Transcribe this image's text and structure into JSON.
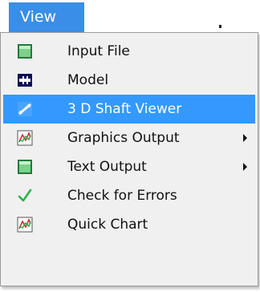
{
  "menubar": {
    "title": "View"
  },
  "menu": {
    "items": [
      {
        "label": "Input File",
        "icon": "input-file-icon",
        "submenu": false,
        "selected": false
      },
      {
        "label": "Model",
        "icon": "model-icon",
        "submenu": false,
        "selected": false
      },
      {
        "label": "3 D Shaft Viewer",
        "icon": "shaft-viewer-icon",
        "submenu": false,
        "selected": true
      },
      {
        "label": "Graphics Output",
        "icon": "chart-icon",
        "submenu": true,
        "selected": false
      },
      {
        "label": "Text Output",
        "icon": "text-output-icon",
        "submenu": true,
        "selected": false
      },
      {
        "label": "Check for Errors",
        "icon": "checkmark-icon",
        "submenu": false,
        "selected": false
      },
      {
        "label": "Quick Chart",
        "icon": "chart-icon",
        "submenu": false,
        "selected": false
      }
    ]
  },
  "colors": {
    "highlight": "#3399ff",
    "title_bg": "#3a8ee6",
    "menu_bg": "#f0f0f0"
  }
}
